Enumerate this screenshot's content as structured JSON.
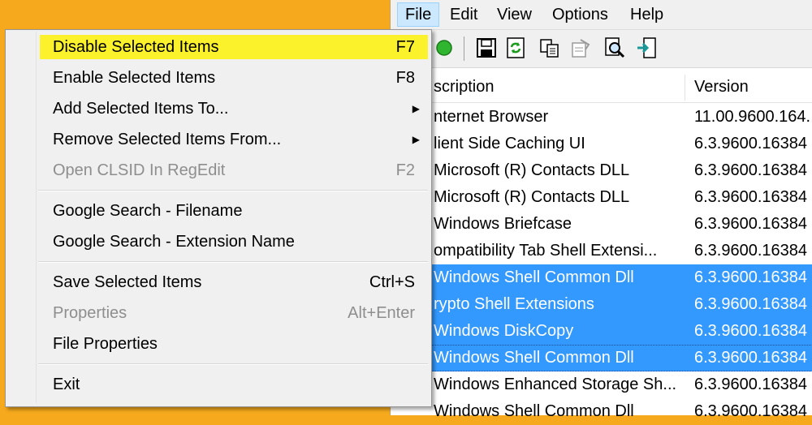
{
  "menubar": {
    "items": [
      "File",
      "Edit",
      "View",
      "Options",
      "Help"
    ]
  },
  "toolbar": {
    "icons": [
      "green-circle-icon",
      "save-icon",
      "refresh-icon",
      "copy-icon",
      "properties-icon",
      "find-icon",
      "exit-icon"
    ]
  },
  "list": {
    "columns": [
      "scription",
      "Version"
    ],
    "rows": [
      {
        "description": "nternet Browser",
        "version": "11.00.9600.164...",
        "selected": false
      },
      {
        "description": "lient Side Caching UI",
        "version": "6.3.9600.16384 ...",
        "selected": false
      },
      {
        "description": "Microsoft (R) Contacts DLL",
        "version": "6.3.9600.16384 ...",
        "selected": false
      },
      {
        "description": "Microsoft (R) Contacts DLL",
        "version": "6.3.9600.16384 ...",
        "selected": false
      },
      {
        "description": "Windows Briefcase",
        "version": "6.3.9600.16384 ...",
        "selected": false
      },
      {
        "description": "ompatibility Tab Shell Extensi...",
        "version": "6.3.9600.16384 ...",
        "selected": false
      },
      {
        "description": "Windows Shell Common Dll",
        "version": "6.3.9600.16384 ...",
        "selected": true
      },
      {
        "description": "rypto Shell Extensions",
        "version": "6.3.9600.16384 ...",
        "selected": true
      },
      {
        "description": "Windows DiskCopy",
        "version": "6.3.9600.16384 ...",
        "selected": true
      },
      {
        "description": "Windows Shell Common Dll",
        "version": "6.3.9600.16384 ...",
        "selected": true
      },
      {
        "description": "Windows Enhanced Storage Sh...",
        "version": "6.3.9600.16384 ...",
        "selected": false
      },
      {
        "description": "Windows Shell Common Dll",
        "version": "6.3.9600.16384 ...",
        "selected": false
      }
    ]
  },
  "file_menu": {
    "items": [
      {
        "label": "Disable Selected Items",
        "shortcut": "F7"
      },
      {
        "label": "Enable Selected Items",
        "shortcut": "F8"
      },
      {
        "label": "Add Selected Items To...",
        "shortcut": ""
      },
      {
        "label": "Remove Selected Items From...",
        "shortcut": ""
      },
      {
        "label": "Open CLSID In RegEdit",
        "shortcut": "F2"
      },
      {
        "label": "Google Search - Filename",
        "shortcut": ""
      },
      {
        "label": "Google Search - Extension Name",
        "shortcut": ""
      },
      {
        "label": "Save Selected Items",
        "shortcut": "Ctrl+S"
      },
      {
        "label": "Properties",
        "shortcut": "Alt+Enter"
      },
      {
        "label": "File Properties",
        "shortcut": ""
      },
      {
        "label": "Exit",
        "shortcut": ""
      }
    ]
  },
  "colors": {
    "desktop": "#f6a91c",
    "highlight": "#fbf22c",
    "selection": "#3399ff",
    "menu_active": "#cce8ff"
  }
}
